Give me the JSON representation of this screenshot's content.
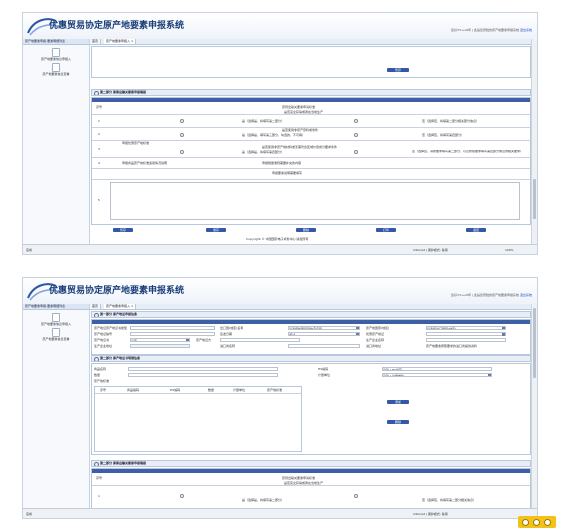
{
  "app": {
    "title": "优惠贸易协定原产地要素申报系统",
    "header_info": "您好!Hi-uu8年 | 此是您登陆的原产地要素申报系统",
    "header_link": "退出系统"
  },
  "sidebar": {
    "header": "原产地要素申报-要素明细列表",
    "items": [
      {
        "label": "原产地要素信息申报入"
      },
      {
        "label": "原产地要素信息查看"
      }
    ]
  },
  "tabs": [
    {
      "label": "首页"
    },
    {
      "label": "原产地要素申报入 ×"
    }
  ],
  "screen1": {
    "top_button": "暂存",
    "section_title": "第二部分 原原出输关要素申报填报",
    "table_header": "序号",
    "col_title_1": "原则出输关要素申请标准",
    "col_title_2": "是否完全获得或者在当地生产",
    "rows": [
      {
        "no": "1",
        "opt_b": "是（选择是，将填写第二部分）",
        "opt_d": "否（选择否，将填第二部分相关部分信息）"
      },
      {
        "no": "2",
        "title": "是否使用非原产原料或零件",
        "opt_b": "是（选择是，填写第三部分，勾选的，不可填）",
        "opt_d": "否（选择否，将填写第四部分）"
      },
      {
        "no": "3",
        "label": "申报优惠原产地标准",
        "title": "是否使用非原产地材料或无需符合区域价值成分要求条件",
        "opt_b": "是（选择是，将填写第四部分）",
        "opt_d": "否（选择否，请按要求填写第二部分，以及按照要求填写第四部分信息的相关要求）"
      },
      {
        "no": "4",
        "label": "申报商品原产地标准适用情况说明",
        "title": "申报规章准则需要补充的内容"
      },
      {
        "no": "5",
        "title": "申报要素说明需要填写"
      }
    ],
    "bottom_buttons": [
      "暂存",
      "保存",
      "删除",
      "打印",
      "返回"
    ],
    "copyright": "Copyright © 中国国际电子商务中心 版权所有",
    "status_left": "完成",
    "status_mode": "Internet | 保护模式: 禁用",
    "status_zoom": "100%"
  },
  "screen2": {
    "section1": "第一部分 原产地证申报信息",
    "fields": [
      {
        "label": "原产地证原产地证书类型",
        "value": ""
      },
      {
        "label": "出口国(地区)名称",
        "value": "请选择优惠贸易协定名称"
      },
      {
        "label": "原产地国家(地区)",
        "value": ""
      },
      {
        "label": "进口国(地区)名称",
        "value": "请选择进口国家(地区)"
      },
      {
        "label": "原产地证编号",
        "value": ""
      },
      {
        "label": "签发日期",
        "value": ""
      },
      {
        "label": "优惠原产地证",
        "value": "是否"
      },
      {
        "label": "原产地证书",
        "value": ""
      },
      {
        "label": "原产地证方",
        "value": "测试"
      },
      {
        "label": "生产企业名称",
        "value": ""
      },
      {
        "label": "生产企业地址",
        "value": ""
      },
      {
        "label": "进口商名称",
        "value": ""
      },
      {
        "label": "进口商地址",
        "value": "原产地要素按照要求的进口商提供资料"
      }
    ],
    "section2": "第二部分 原产地证书明细信息",
    "detail_fields": [
      {
        "label": "商品名称",
        "value": ""
      },
      {
        "label": "HS编码",
        "value": "请输入HS编码"
      },
      {
        "label": "数量",
        "value": ""
      },
      {
        "label": "计量单位",
        "value": "请输入计量单位"
      },
      {
        "label": "原产地标准",
        "value": ""
      }
    ],
    "table_columns": [
      "序号",
      "商品编码",
      "HS编码",
      "数量",
      "计量单位",
      "原产地标准"
    ],
    "add_button": "添加",
    "delete_button": "删除",
    "section3": "第二部分 原原出输关要素申报填报",
    "row1": {
      "no": "1",
      "opt_b": "是（选择是，将填写第二部分）",
      "opt_d": "否（选择否，将填写第二部分相关信息）"
    },
    "col_title_1": "原则出输关要素申请标准",
    "col_title_2": "是否完全获得或者在当地生产",
    "status_left": "完成",
    "status_mode": "Internet | 保护模式: 禁用"
  }
}
